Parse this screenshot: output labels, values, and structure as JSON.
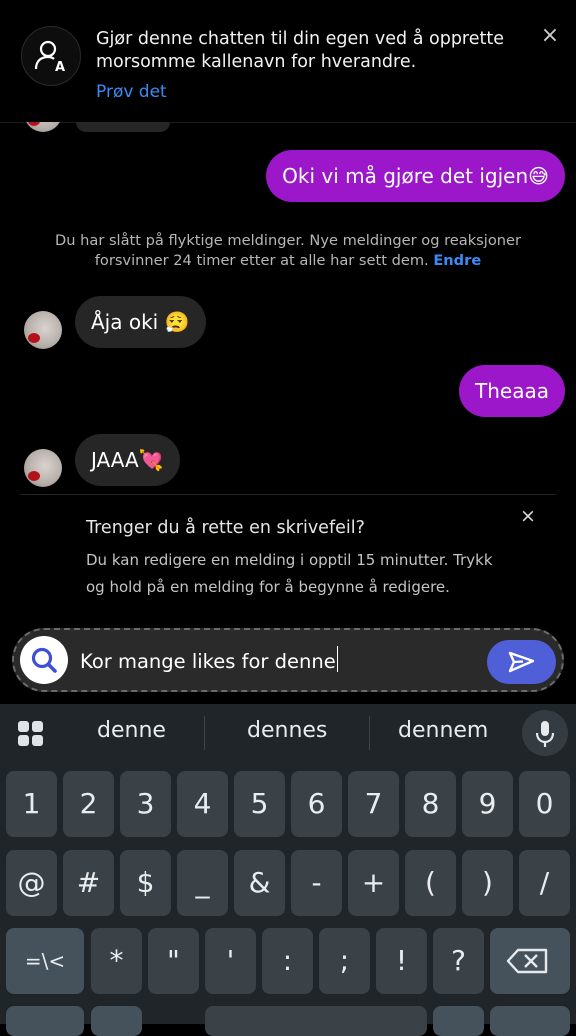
{
  "banner": {
    "text": "Gjør denne chatten til din egen ved å opprette morsomme kallenavn for hverandre.",
    "link": "Prøv det",
    "close": "×"
  },
  "messages": {
    "out1": "Oki vi må gjøre det igjen😅",
    "in1": "Åja oki 😮‍💨",
    "out2": "Theaaa",
    "in2": "JAAA💘"
  },
  "system_note": {
    "text": "Du har slått på flyktige meldinger. Nye meldinger og reaksjoner forsvinner 24 timer etter at alle har sett dem.",
    "link": "Endre"
  },
  "tip": {
    "title": "Trenger du å rette en skrivefeil?",
    "body": "Du kan redigere en melding i opptil 15 minutter. Trykk og hold på en melding for å begynne å redigere.",
    "close": "×"
  },
  "composer": {
    "value": "Kor mange likes for denne"
  },
  "keyboard": {
    "suggestions": [
      "denne",
      "dennes",
      "dennem"
    ],
    "row1": [
      "1",
      "2",
      "3",
      "4",
      "5",
      "6",
      "7",
      "8",
      "9",
      "0"
    ],
    "row2": [
      "@",
      "#",
      "$",
      "_",
      "&",
      "-",
      "+",
      "(",
      ")",
      "/"
    ],
    "row3_mod": "=\\<",
    "row3": [
      "*",
      "\"",
      "'",
      ":",
      ";",
      "!",
      "?"
    ]
  },
  "colors": {
    "outgoing_bubble": "#9b17c9",
    "incoming_bubble": "#262626",
    "link": "#3b8bf6",
    "send_button": "#4f5fd8"
  }
}
